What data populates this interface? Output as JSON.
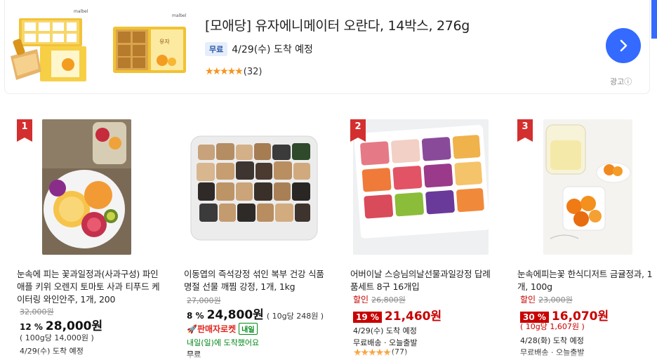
{
  "ad": {
    "title": "[모애당] 유자에니메이터 오란다, 14박스, 276g",
    "free_badge": "무료",
    "delivery": "4/29(수) 도착 예정",
    "stars": "★★★★★",
    "review_count": "(32)",
    "ad_label": "광고ⓘ",
    "next_icon": "chevron-right-icon",
    "brand_text": "malbel mama's"
  },
  "products": [
    {
      "rank": "1",
      "name": "눈속에 피는 꽃과일정과(사과구성) 파인애플 키위 오렌지 토마토 사과 티푸드 케이터링 와인안주, 1개, 200",
      "original_price": "32,000원",
      "discount": "12 %",
      "price": "28,000원",
      "unit_price": "( 100g당 14,000원 )",
      "delivery": "4/29(수) 도착 예정"
    },
    {
      "rank": "",
      "name": "이동엽의 즉석강정 섞인 복부 건강 식품 명절 선물 깨찜 강정, 1개, 1kg",
      "original_price": "27,000원",
      "discount": "8 %",
      "price": "24,800원",
      "unit_price": "( 10g당 248원 )",
      "rocket": "🚀판매자로켓",
      "rocket_tag": "내일",
      "delivery": "내일(일)에 도착했어요",
      "extra": "무료"
    },
    {
      "rank": "2",
      "name": "어버이날 스승님의날선물과일강정 답례품세트 8구 16개입",
      "discount_label": "할인",
      "original_price": "26,800원",
      "discount": "19 %",
      "price": "21,460원",
      "delivery": "4/29(수) 도착 예정",
      "shipping": "무료배송 · 오늘출발",
      "stars": "★★★★★",
      "review_count": "(77)"
    },
    {
      "rank": "3",
      "name": "눈속에피는꽃 한식디저트 금귤정과, 1개, 100g",
      "discount_label": "할인",
      "original_price": "23,000원",
      "discount": "30 %",
      "price": "16,070원",
      "unit_price": "( 10g당 1,607원 )",
      "delivery": "4/28(화) 도착 예정",
      "shipping": "무료배송 · 오늘출발"
    }
  ]
}
